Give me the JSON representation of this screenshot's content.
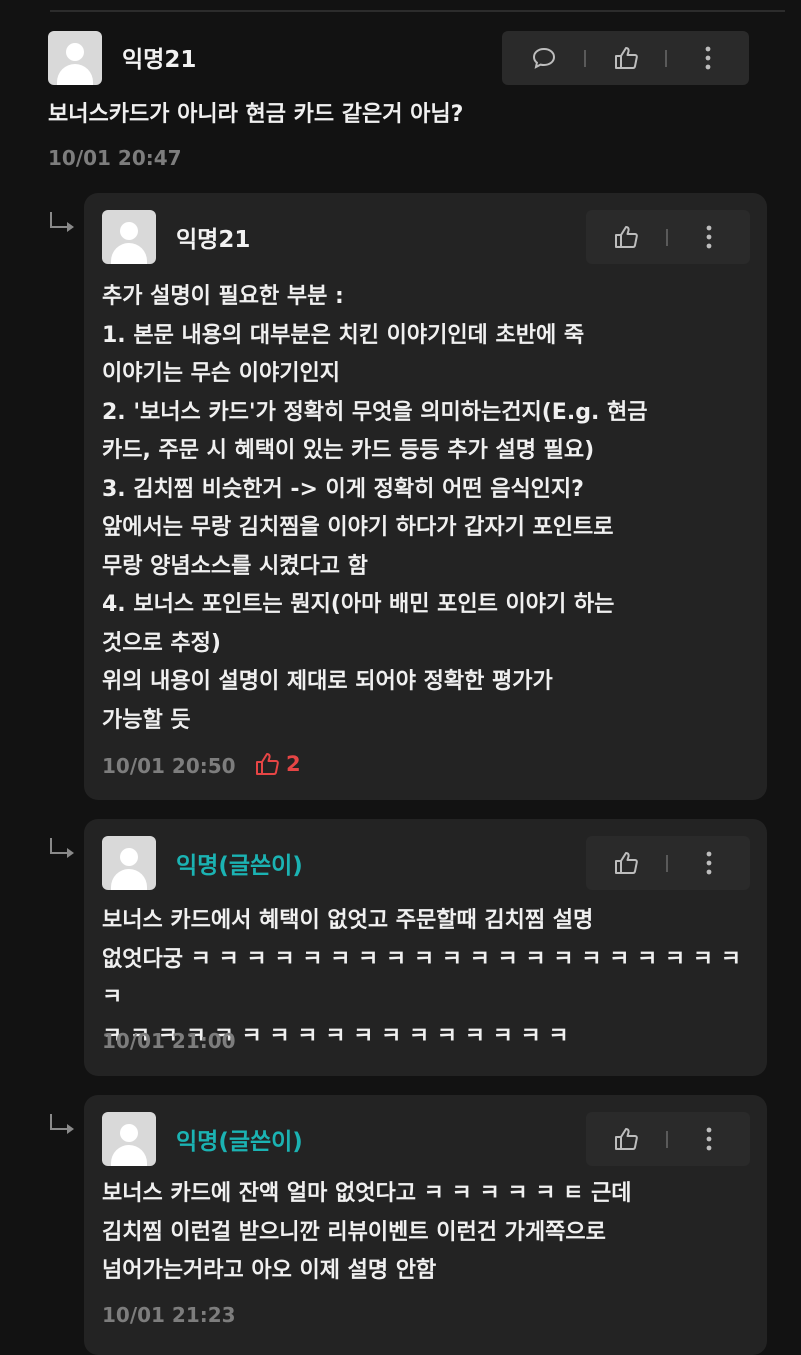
{
  "comments": [
    {
      "nickname": "익명21",
      "text": "보너스카드가 아니라 현금 카드 같은거 아님?",
      "date": "10/01 20:47"
    },
    {
      "nickname": "익명21",
      "text": "추가 설명이 필요한 부분 :\n1. 본문 내용의 대부분은 치킨 이야기인데 초반에 죽\n이야기는 무슨 이야기인지\n2. '보너스 카드'가 정확히 무엇을 의미하는건지(E.g. 현금\n카드, 주문 시 혜택이 있는 카드 등등 추가 설명 필요)\n3. 김치찜 비슷한거 -> 이게 정확히 어떤 음식인지?\n앞에서는 무랑 김치찜을 이야기 하다가 갑자기 포인트로\n무랑 양념소스를 시켰다고 함\n4. 보너스 포인트는 뭔지(아마 배민 포인트 이야기 하는\n것으로 추정)\n위의 내용이 설명이 제대로 되어야 정확한 평가가\n가능할 듯",
      "date": "10/01 20:50",
      "likes": "2"
    },
    {
      "nickname": "익명(글쓴이)",
      "text": "보너스 카드에서 혜택이 없엇고 주문할때 김치찜 설명\n없엇다궁 ㅋ ㅋ ㅋ ㅋ ㅋ ㅋ ㅋ ㅋ ㅋ ㅋ ㅋ ㅋ ㅋ ㅋ ㅋ ㅋ ㅋ ㅋ ㅋ ㅋ ㅋ\nㅋ ㅋ ㅋ ㅋ ㅋ ㅋ ㅋ ㅋ ㅋ ㅋ ㅋ ㅋ ㅋ ㅋ ㅋ ㅋ ㅋ",
      "date": "10/01 21:00"
    },
    {
      "nickname": "익명(글쓴이)",
      "text": "보너스 카드에 잔액 얼마 없엇다고 ㅋ ㅋ ㅋ ㅋ ㅋ ㅌ 근데\n김치찜 이런걸 받으니깐 리뷰이벤트 이런건 가게쪽으로\n넘어가는거라고 아오 이제 설명 안함",
      "date": "10/01 21:23"
    }
  ],
  "colors": {
    "background": "#121212",
    "card": "#232323",
    "author_nick": "#1bb3b3",
    "like_red": "#e64545",
    "date": "#7d7d7d"
  },
  "icons": [
    "comment-icon",
    "thumbs-up-icon",
    "more-vertical-icon",
    "reply-arrow-icon",
    "avatar-icon"
  ]
}
